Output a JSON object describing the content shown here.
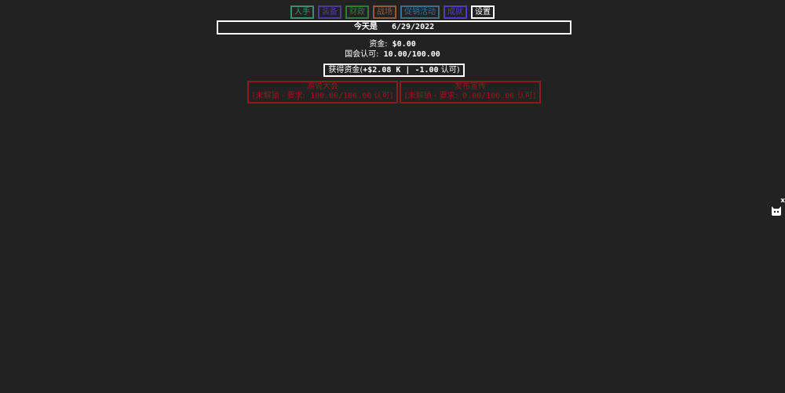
{
  "tabs": [
    "人手",
    "装备",
    "财政",
    "战场",
    "促销活动",
    "成就",
    "设置"
  ],
  "date": {
    "label": "今天是",
    "value": "6/29/2022"
  },
  "stats": {
    "funds_label": "资金:",
    "funds_value": "$0.00",
    "approval_label": "国会认可:",
    "approval_value": "10.00/100.00"
  },
  "gain_button": {
    "label": "获得资金",
    "open": "(",
    "money": "+$2.08 K",
    "sep": " | ",
    "approval": "-1.00",
    "unit": " 认可",
    "close": ")"
  },
  "locked_actions": [
    {
      "title": "游说大会",
      "status": "[未解锁 - 要求:",
      "requirement": "100.00/100.00",
      "unit": " 认可]"
    },
    {
      "title": "发布宣传",
      "status": "[未解锁 - 要求:",
      "requirement": "0.00/100.00",
      "unit": " 认可]"
    }
  ],
  "corner_close": "x",
  "icons": {
    "corner": "cat-icon"
  }
}
